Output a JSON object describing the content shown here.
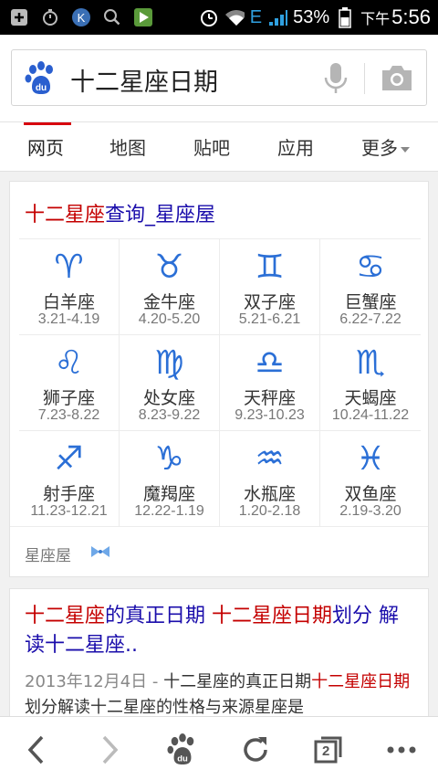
{
  "status_bar": {
    "network": "E",
    "battery": "53%",
    "time_prefix": "下午",
    "time": "5:56"
  },
  "search": {
    "query": "十二星座日期"
  },
  "tabs": [
    {
      "label": "网页"
    },
    {
      "label": "地图"
    },
    {
      "label": "贴吧"
    },
    {
      "label": "应用"
    },
    {
      "label": "更多"
    }
  ],
  "card1": {
    "title_red": "十二星座",
    "title_blue": "查询_星座屋",
    "signs": [
      {
        "symbol": "♈",
        "name": "白羊座",
        "dates": "3.21-4.19"
      },
      {
        "symbol": "♉",
        "name": "金牛座",
        "dates": "4.20-5.20"
      },
      {
        "symbol": "♊",
        "name": "双子座",
        "dates": "5.21-6.21"
      },
      {
        "symbol": "♋",
        "name": "巨蟹座",
        "dates": "6.22-7.22"
      },
      {
        "symbol": "♌",
        "name": "狮子座",
        "dates": "7.23-8.22"
      },
      {
        "symbol": "♍",
        "name": "处女座",
        "dates": "8.23-9.22"
      },
      {
        "symbol": "♎",
        "name": "天秤座",
        "dates": "9.23-10.23"
      },
      {
        "symbol": "♏",
        "name": "天蝎座",
        "dates": "10.24-11.22"
      },
      {
        "symbol": "♐",
        "name": "射手座",
        "dates": "11.23-12.21"
      },
      {
        "symbol": "♑",
        "name": "魔羯座",
        "dates": "12.22-1.19"
      },
      {
        "symbol": "♒",
        "name": "水瓶座",
        "dates": "1.20-2.18"
      },
      {
        "symbol": "♓",
        "name": "双鱼座",
        "dates": "2.19-3.20"
      }
    ],
    "source": "星座屋"
  },
  "card2": {
    "title_parts": [
      {
        "text": "十二星座",
        "color": "red"
      },
      {
        "text": "的真正日期 ",
        "color": "blue"
      },
      {
        "text": "十二星座日期",
        "color": "red"
      },
      {
        "text": "划分 解读十二星座..",
        "color": "blue"
      }
    ],
    "snippet_date": "2013年12月4日 - ",
    "snippet_parts": [
      {
        "text": "十二星座的真正日期",
        "color": "normal"
      },
      {
        "text": "十二星座日期",
        "color": "red"
      },
      {
        "text": "划分解读十二星座的性格与来源星座是",
        "color": "normal"
      }
    ]
  },
  "bottom_nav": {
    "tab_count": "2"
  }
}
